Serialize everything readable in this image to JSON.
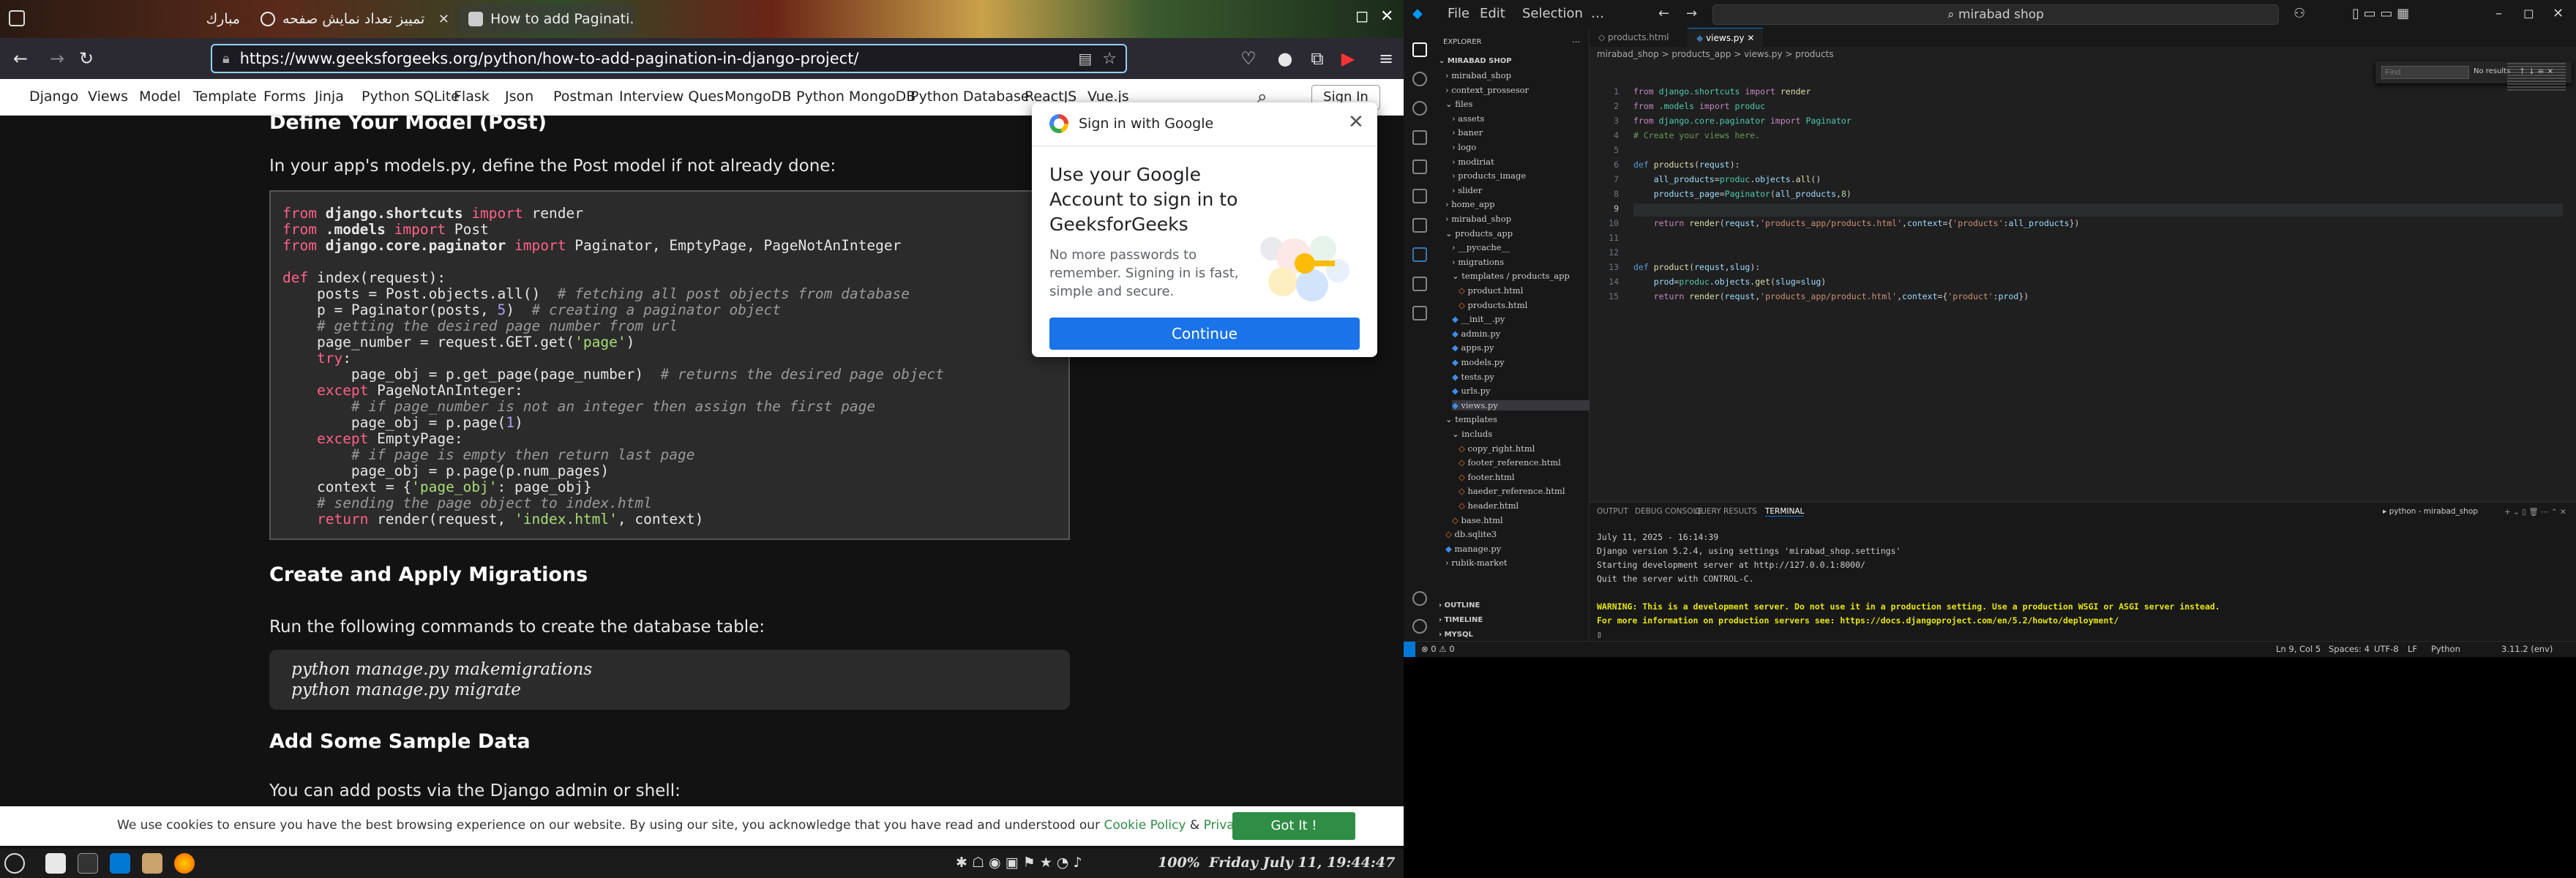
{
  "firefox": {
    "tabs": [
      {
        "label": "مبارك"
      },
      {
        "label": "تمييز تعداد نمايش صفحه"
      },
      {
        "label": "How to add Paginati..."
      }
    ],
    "url_prefix": "https://www.",
    "url_domain": "geeksforgeeks.org",
    "url_path": "/python/how-to-add-pagination-in-django-project/",
    "nav": [
      "Django",
      "Views",
      "Model",
      "Template",
      "Forms",
      "Jinja",
      "Python SQLite",
      "Flask",
      "Json",
      "Postman",
      "Interview Ques",
      "MongoDB",
      "Python MongoDB",
      "Python Database",
      "ReactJS",
      "Vue.js"
    ],
    "signin": "Sign In",
    "page": {
      "heading_top": "Define Your Model (Post)",
      "para1": "In your app's models.py, define the Post model if not already done:",
      "heading2": "Create and Apply Migrations",
      "para2": "Run the following commands to create the database table:",
      "cmd1": "python manage.py makemigrations",
      "cmd2": "python manage.py migrate",
      "heading3": "Add Some Sample Data",
      "para3": "You can add posts via the Django admin or shell:"
    },
    "cookie": {
      "text": "We use cookies to ensure you have the best browsing experience on our website. By using our site, you acknowledge that you have read and understood our ",
      "link1": "Cookie Policy",
      "amp": " & ",
      "link2": "Privacy Policy",
      "button": "Got It !"
    },
    "google_popup": {
      "header": "Sign in with Google",
      "title": "Use your Google Account to sign in to GeeksforGeeks",
      "subtitle": "No more passwords to remember. Signing in is fast, simple and secure.",
      "button": "Continue"
    }
  },
  "taskbar": {
    "zoom": "100%",
    "datetime": "Friday July 11, 19:44:47"
  },
  "vscode": {
    "menu": [
      "File",
      "Edit",
      "Selection",
      "…"
    ],
    "search": "mirabad shop",
    "explorer_title": "EXPLORER",
    "project": "MIRABAD SHOP",
    "tree": [
      {
        "t": "mirabad_shop",
        "d": 1,
        "f": false
      },
      {
        "t": "context_prossesor",
        "d": 1,
        "f": false
      },
      {
        "t": "files",
        "d": 1,
        "f": false,
        "open": true
      },
      {
        "t": "assets",
        "d": 2,
        "f": false
      },
      {
        "t": "baner",
        "d": 2,
        "f": false
      },
      {
        "t": "logo",
        "d": 2,
        "f": false
      },
      {
        "t": "modiriat",
        "d": 2,
        "f": false
      },
      {
        "t": "products_image",
        "d": 2,
        "f": false
      },
      {
        "t": "slider",
        "d": 2,
        "f": false
      },
      {
        "t": "home_app",
        "d": 1,
        "f": false
      },
      {
        "t": "mirabad_shop",
        "d": 1,
        "f": false
      },
      {
        "t": "products_app",
        "d": 1,
        "f": false,
        "open": true
      },
      {
        "t": "__pycache__",
        "d": 2,
        "f": false
      },
      {
        "t": "migrations",
        "d": 2,
        "f": false
      },
      {
        "t": "templates / products_app",
        "d": 2,
        "f": false,
        "open": true
      },
      {
        "t": "product.html",
        "d": 3,
        "f": true
      },
      {
        "t": "products.html",
        "d": 3,
        "f": true
      },
      {
        "t": "__init__.py",
        "d": 2,
        "f": true
      },
      {
        "t": "admin.py",
        "d": 2,
        "f": true
      },
      {
        "t": "apps.py",
        "d": 2,
        "f": true
      },
      {
        "t": "models.py",
        "d": 2,
        "f": true
      },
      {
        "t": "tests.py",
        "d": 2,
        "f": true
      },
      {
        "t": "urls.py",
        "d": 2,
        "f": true
      },
      {
        "t": "views.py",
        "d": 2,
        "f": true,
        "sel": true
      },
      {
        "t": "templates",
        "d": 1,
        "f": false,
        "open": true
      },
      {
        "t": "includs",
        "d": 2,
        "f": false,
        "open": true
      },
      {
        "t": "copy_right.html",
        "d": 3,
        "f": true
      },
      {
        "t": "footer_reference.html",
        "d": 3,
        "f": true
      },
      {
        "t": "footer.html",
        "d": 3,
        "f": true
      },
      {
        "t": "haeder_reference.html",
        "d": 3,
        "f": true
      },
      {
        "t": "header.html",
        "d": 3,
        "f": true
      },
      {
        "t": "base.html",
        "d": 2,
        "f": true
      },
      {
        "t": "db.sqlite3",
        "d": 1,
        "f": true
      },
      {
        "t": "manage.py",
        "d": 1,
        "f": true
      },
      {
        "t": "rubik-market",
        "d": 1,
        "f": false
      }
    ],
    "outline": "OUTLINE",
    "timeline": "TIMELINE",
    "mysql": "MYSQL",
    "tab1": "products.html",
    "tab2": "views.py",
    "breadcrumb": "mirabad_shop > products_app > views.py > products",
    "find_placeholder": "Find",
    "find_result": "No results",
    "panel_tabs": [
      "OUTPUT",
      "DEBUG CONSOLE",
      "QUERY RESULTS",
      "TERMINAL"
    ],
    "terminal_label": "python - mirabad_shop",
    "terminal": [
      "July 11, 2025 - 16:14:39",
      "Django version 5.2.4, using settings 'mirabad_shop.settings'",
      "Starting development server at http://127.0.0.1:8000/",
      "Quit the server with CONTROL-C.",
      "",
      "WARNING: This is a development server. Do not use it in a production setting. Use a production WSGI or ASGI server instead.",
      "For more information on production servers see: https://docs.djangoproject.com/en/5.2/howto/deployment/"
    ],
    "status": {
      "left": "⊗ 0 ⚠ 0",
      "pos": "Ln 9, Col 5",
      "spaces": "Spaces: 4",
      "enc": "UTF-8",
      "eol": "LF",
      "lang": "Python",
      "ver": "3.11.2 (env)"
    }
  },
  "colors": {
    "gfg_green": "#2f8d46",
    "google_blue": "#1a73e8",
    "vscode_bg": "#1f1f1f"
  }
}
